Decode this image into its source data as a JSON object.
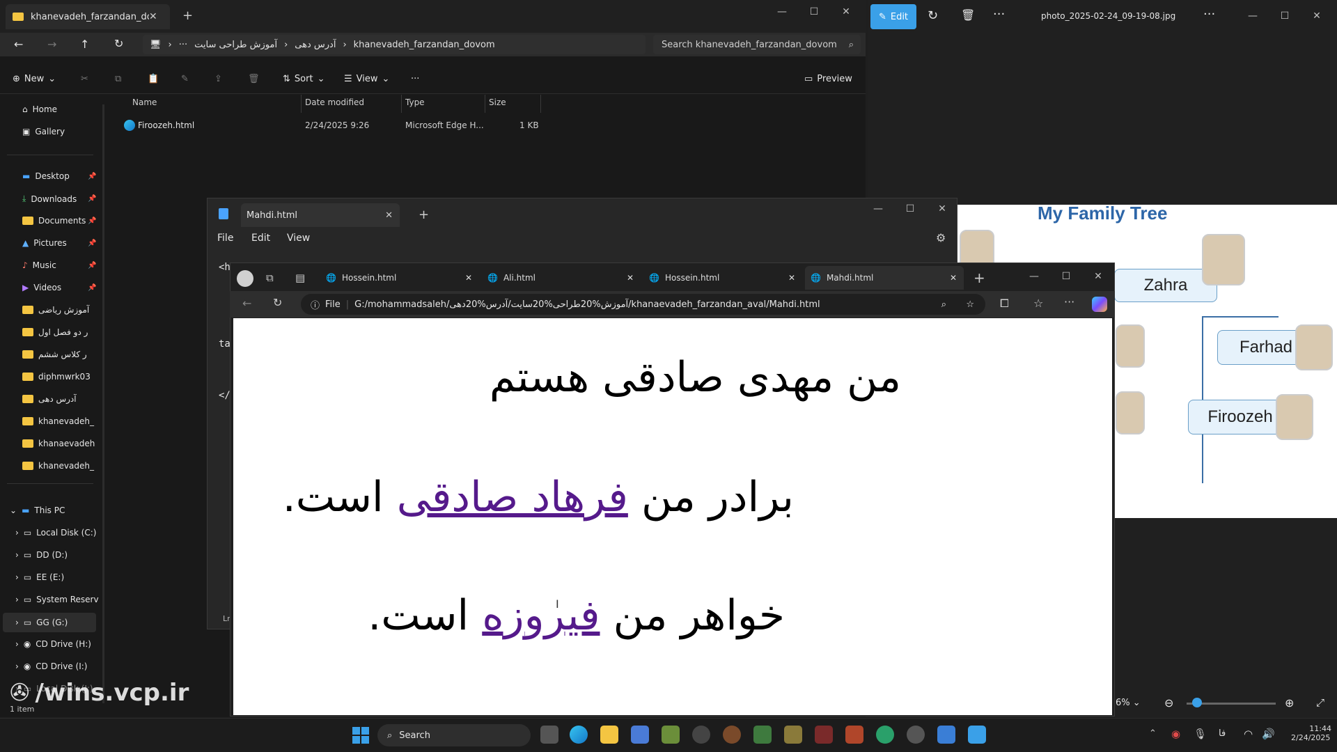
{
  "explorer": {
    "tab_title": "khanevadeh_farzandan_dovon",
    "address": [
      "آموزش طراحی سایت",
      "آدرس دهی",
      "khanevadeh_farzandan_dovom"
    ],
    "search_placeholder": "Search khanevadeh_farzandan_dovom",
    "cmd": {
      "new": "New",
      "sort": "Sort",
      "view": "View",
      "preview": "Preview"
    },
    "columns": {
      "name": "Name",
      "date": "Date modified",
      "type": "Type",
      "size": "Size"
    },
    "file": {
      "name": "Firoozeh.html",
      "date": "2/24/2025 9:26",
      "type": "Microsoft Edge H...",
      "size": "1 KB"
    },
    "sidebar": [
      "Home",
      "Gallery",
      "Desktop",
      "Downloads",
      "Documents",
      "Pictures",
      "Music",
      "Videos",
      "آموزش ریاضی",
      "ر دو فصل اول",
      "ر کلاس ششم",
      "diphmwrk03",
      "آدرس دهی",
      "khanevadeh_",
      "khanaevadeh",
      "khanevadeh_",
      "This PC",
      "Local Disk (C:)",
      "DD (D:)",
      "EE (E:)",
      "System Reserv",
      "GG (G:)",
      "CD Drive (H:)",
      "CD Drive (I:)",
      "Local Disk (J:)"
    ],
    "status": "1 item"
  },
  "photos": {
    "edit_label": "Edit",
    "filename": "photo_2025-02-24_09-19-08.jpg",
    "image_title": "My Family Tree",
    "nodes": [
      "Zahra",
      "Farhad",
      "Firoozeh"
    ],
    "zoom": "6%"
  },
  "notepad": {
    "tab": "Mahdi.html",
    "menu": [
      "File",
      "Edit",
      "View"
    ],
    "fragments": [
      "<h",
      "ta",
      "</",
      "Lr"
    ]
  },
  "edge": {
    "tabs": [
      "Hossein.html",
      "Ali.html",
      "Hossein.html",
      "Mahdi.html"
    ],
    "file_label": "File",
    "url": "G:/mohammadsaleh/آموزش%20طراحی%20سایت/آدرس%20دهی/khanaevadeh_farzandan_aval/Mahdi.html",
    "line1": "من مهدی صادقی هستم",
    "line2_pre": "برادر من ",
    "line2_link": "فرهاد صادقی",
    "line2_post": " است.",
    "line3_pre": "خواهر من ",
    "line3_link": "فیروزه",
    "line3_post": " است."
  },
  "taskbar": {
    "search": "Search",
    "time": "11:44",
    "date": "2/24/2025",
    "lang": "فا"
  },
  "watermark": "/wins.vcp.ir"
}
